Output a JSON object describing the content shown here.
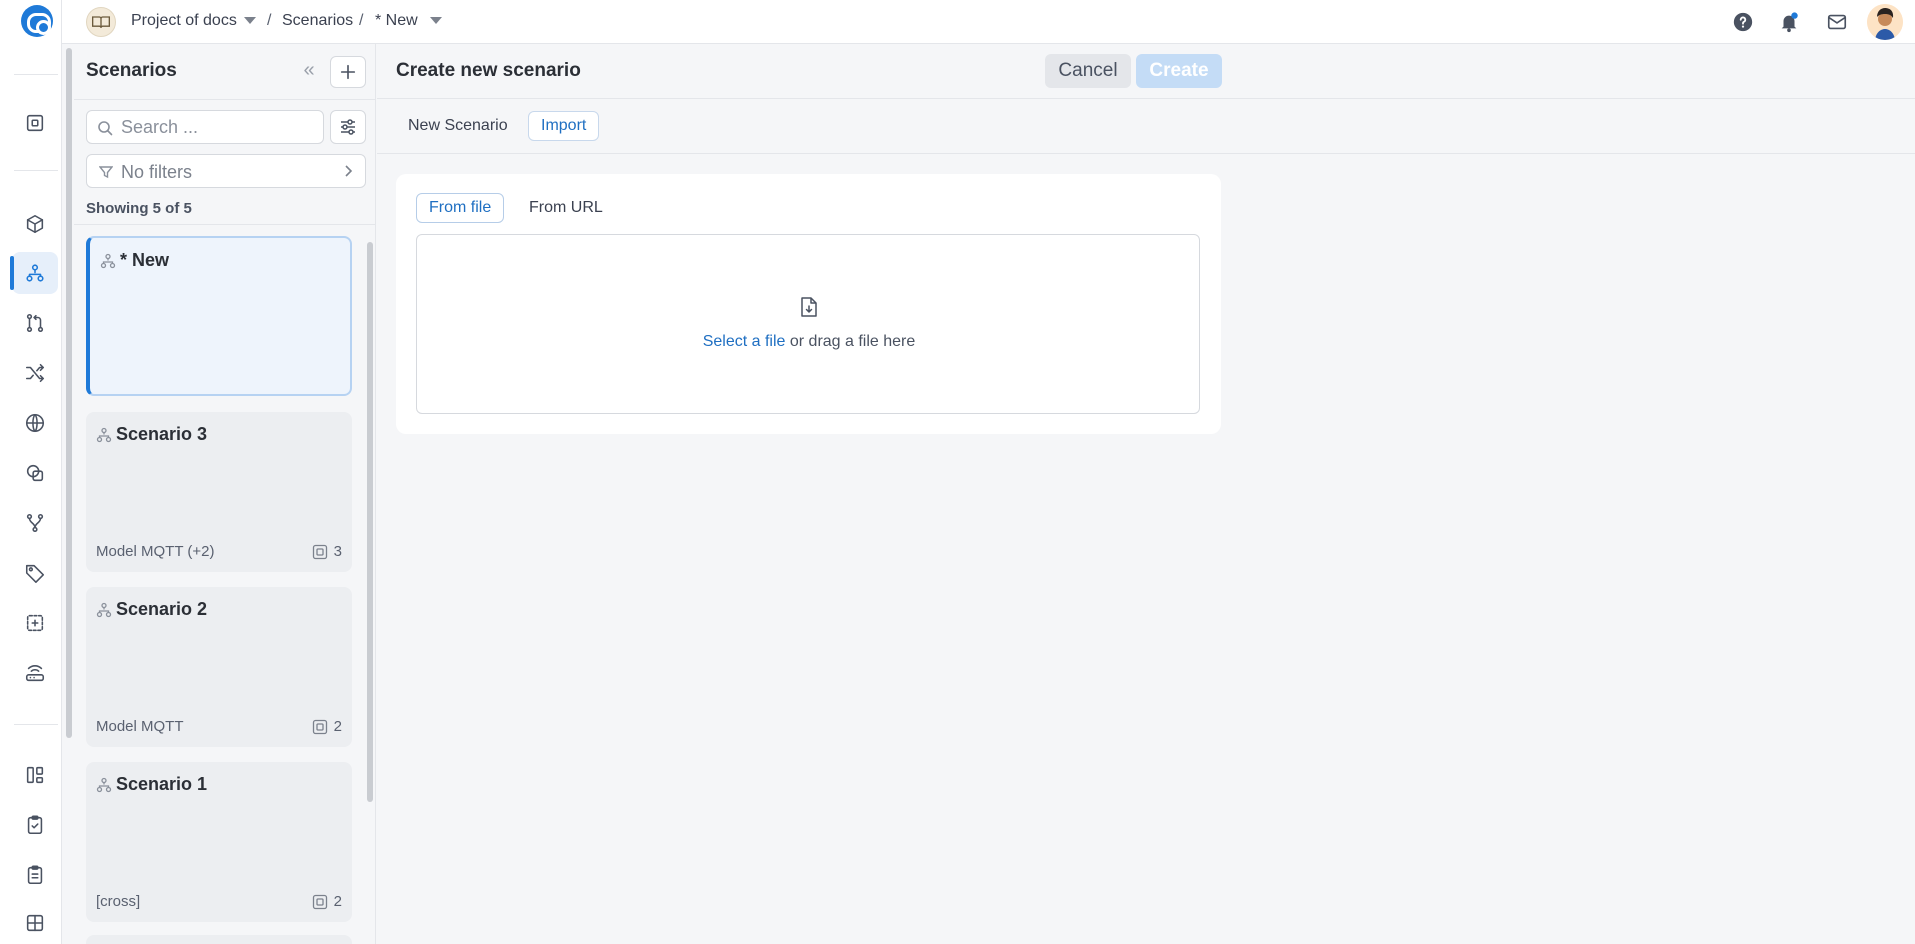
{
  "topbar": {
    "project": "Project of docs",
    "sep1": "/",
    "section": "Scenarios",
    "sep2": "/",
    "current": "* New",
    "icons": [
      "help-icon",
      "bell-icon",
      "mail-icon",
      "avatar"
    ]
  },
  "rail": {
    "items": [
      "dashboard",
      "models",
      "scenarios",
      "pull-requests",
      "shuffle",
      "globe",
      "shapes",
      "branches",
      "tags",
      "insert",
      "router",
      "layout",
      "clipboard-check",
      "clipboard-list",
      "grid"
    ],
    "active": "scenarios"
  },
  "sidebar": {
    "title": "Scenarios",
    "search_placeholder": "Search ...",
    "filters_label": "No filters",
    "showing": "Showing 5 of 5",
    "items": [
      {
        "title": "* New",
        "model": "",
        "count": ""
      },
      {
        "title": "Scenario 3",
        "model": "Model MQTT (+2)",
        "count": "3"
      },
      {
        "title": "Scenario 2",
        "model": "Model MQTT",
        "count": "2"
      },
      {
        "title": "Scenario 1",
        "model": "[cross]",
        "count": "2"
      }
    ]
  },
  "main": {
    "title": "Create new scenario",
    "cancel_label": "Cancel",
    "create_label": "Create",
    "tabs": [
      {
        "label": "New Scenario"
      },
      {
        "label": "Import"
      }
    ],
    "import": {
      "tabs": [
        {
          "label": "From file"
        },
        {
          "label": "From URL"
        }
      ],
      "select_link": "Select a file",
      "drag_text": " or drag a file here"
    }
  },
  "colors": {
    "accent": "#1f7ad8",
    "create_disabled": "#c4dcf6"
  }
}
